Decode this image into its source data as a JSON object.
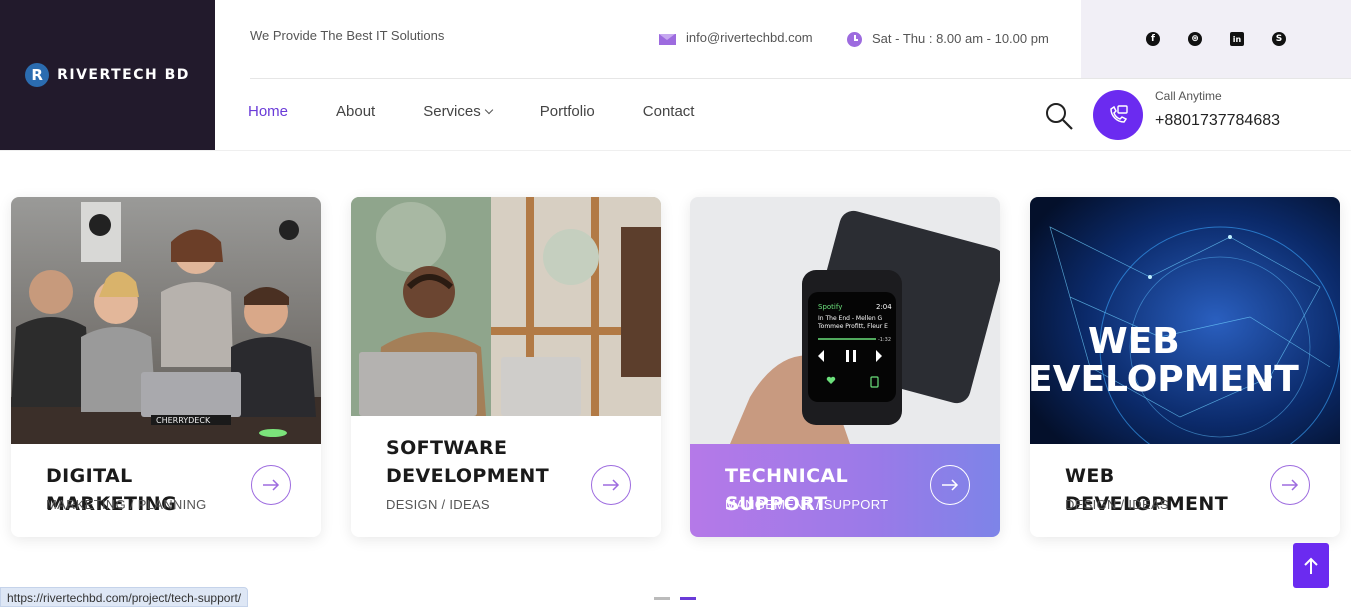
{
  "brand": {
    "logo_letter": "R",
    "name": "RIVERTECH BD"
  },
  "topbar": {
    "tagline": "We Provide The Best IT Solutions",
    "email": "info@rivertechbd.com",
    "hours": "Sat - Thu : 8.00 am - 10.00 pm"
  },
  "social": [
    {
      "icon": "facebook-icon",
      "glyph": "f"
    },
    {
      "icon": "dribbble-icon",
      "glyph": "⊛"
    },
    {
      "icon": "linkedin-icon",
      "glyph": "in"
    },
    {
      "icon": "skype-icon",
      "glyph": "S"
    }
  ],
  "nav": {
    "items": [
      {
        "label": "Home",
        "active": true
      },
      {
        "label": "About"
      },
      {
        "label": "Services",
        "dropdown": true
      },
      {
        "label": "Portfolio"
      },
      {
        "label": "Contact"
      }
    ]
  },
  "call": {
    "label": "Call Anytime",
    "number": "+8801737784683"
  },
  "cards": [
    {
      "title": "DIGITAL MARKETING",
      "subtitle": "MARKETING / PLANNING"
    },
    {
      "title": "SOFTWARE DEVELOPMENT",
      "subtitle": "DESIGN / IDEAS"
    },
    {
      "title": "TECHNICAL SUPPORT",
      "subtitle": "MANGEMENT / SUPPORT"
    },
    {
      "title": "WEB DEVELOPMENT",
      "subtitle": "DESIGN / IDEAS"
    }
  ],
  "images": {
    "watch_app": "Spotify",
    "watch_time": "2:04",
    "watch_track": "In The End - Mellen G",
    "watch_artist": "Tommee Profitt, Fleur E",
    "watch_remaining": "-1:32",
    "web_text_1": "WEB",
    "web_text_2": "EVELOPMENT",
    "laptop_sticker": "CHERRYDECK"
  },
  "status_url": "https://rivertechbd.com/project/tech-support/",
  "colors": {
    "accent": "#6b2bf0",
    "dark": "#221a2c",
    "highlight_start": "#b579e8",
    "highlight_end": "#7d84e8"
  }
}
